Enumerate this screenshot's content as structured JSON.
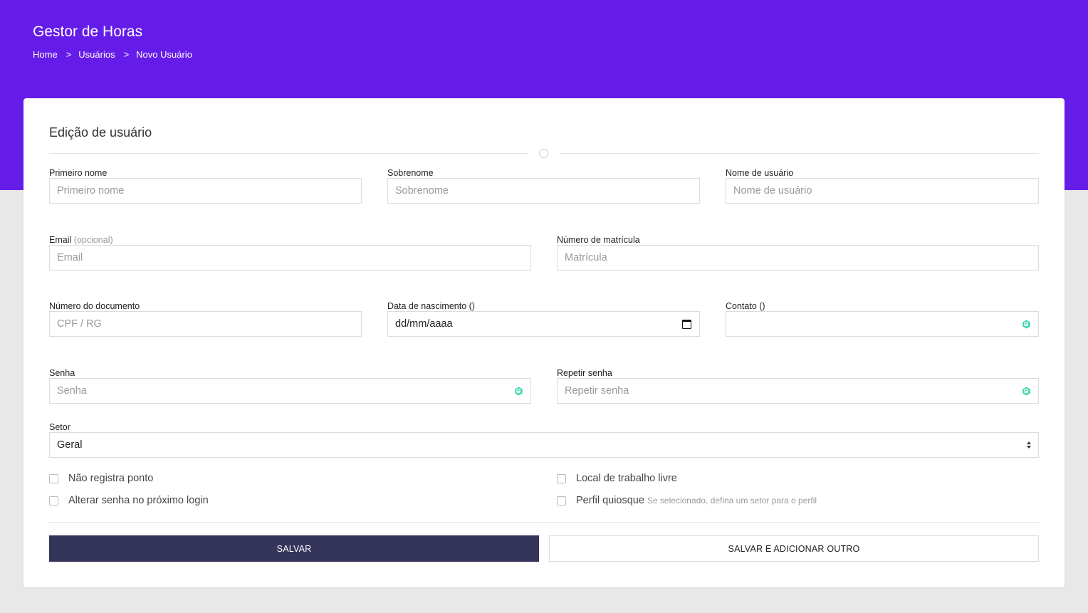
{
  "header": {
    "app_title": "Gestor de Horas",
    "breadcrumb": [
      {
        "label": "Home"
      },
      {
        "label": "Usuários"
      },
      {
        "label": "Novo Usuário"
      }
    ],
    "separator": ">"
  },
  "form": {
    "title": "Edição de usuário",
    "fields": {
      "first_name": {
        "label": "Primeiro nome",
        "placeholder": "Primeiro nome"
      },
      "last_name": {
        "label": "Sobrenome",
        "placeholder": "Sobrenome"
      },
      "username": {
        "label": "Nome de usuário",
        "placeholder": "Nome de usuário"
      },
      "email": {
        "label": "Email",
        "optional": "(opcional)",
        "placeholder": "Email"
      },
      "registration": {
        "label": "Número de matrícula",
        "placeholder": "Matrícula"
      },
      "document": {
        "label": "Número do documento",
        "placeholder": "CPF / RG"
      },
      "birth_date": {
        "label": "Data de nascimento ()",
        "value": "dd/mm/aaaa"
      },
      "contact": {
        "label": "Contato ()",
        "placeholder": ""
      },
      "password": {
        "label": "Senha",
        "placeholder": "Senha"
      },
      "repeat_password": {
        "label": "Repetir senha",
        "placeholder": "Repetir senha"
      },
      "sector": {
        "label": "Setor",
        "selected": "Geral"
      }
    },
    "checkboxes": {
      "no_clock": {
        "label": "Não registra ponto",
        "checked": false
      },
      "free_workplace": {
        "label": "Local de trabalho livre",
        "checked": false
      },
      "change_password": {
        "label": "Alterar senha no próximo login",
        "checked": false
      },
      "kiosk_profile": {
        "label": "Perfil quiosque",
        "hint": "Se selecionado, defina um setor para o perfil",
        "checked": false
      }
    },
    "buttons": {
      "save": "SALVAR",
      "save_add": "SALVAR E ADICIONAR OUTRO"
    }
  },
  "colors": {
    "hero": "#651ce8",
    "primary_button": "#35345a",
    "page_background": "#e8e8e8",
    "password_manager_icon": "#3dd6b0"
  },
  "icons": [
    "calendar-icon",
    "password-manager-icon",
    "select-arrows-icon",
    "divider-circle-icon"
  ]
}
